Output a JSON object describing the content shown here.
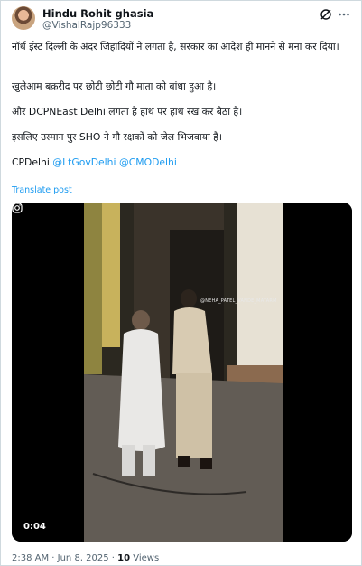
{
  "author": {
    "display_name": "Hindu Rohit ghasia",
    "handle": "@VishalRajp96333"
  },
  "tweet": {
    "paragraphs": [
      "नॉर्थ ईस्ट दिल्ली के अंदर जिहादियों ने लगता है, सरकार का आदेश ही मानने से मना कर दिया।",
      "खुलेआम बक़रीद पर छोटी छोटी गौ माता को बांधा हुआ है।",
      "और DCPNEast Delhi लगता है हाथ पर हाथ रख कर बैठा है।",
      "इसलिए उस्मान पुर SHO ने गौ रक्षकों को जेल भिजवाया है।"
    ],
    "mentions": [
      "CPDelhi",
      "@LtGovDelhi",
      "@CMODelhi"
    ],
    "translate_label": "Translate post"
  },
  "video": {
    "duration": "0:04",
    "watermark": "@NEHA_PATEL_VANDE_MATARM"
  },
  "meta": {
    "time_date": "2:38 AM · Jun 8, 2025 · ",
    "views_count": "10",
    "views_label": " Views"
  },
  "icons": {
    "grok": "grok-slash-icon",
    "more": "more-dots-icon",
    "instagram": "instagram-icon"
  },
  "colors": {
    "link": "#1d9bf0",
    "secondary": "#536471",
    "text": "#0f1419"
  }
}
